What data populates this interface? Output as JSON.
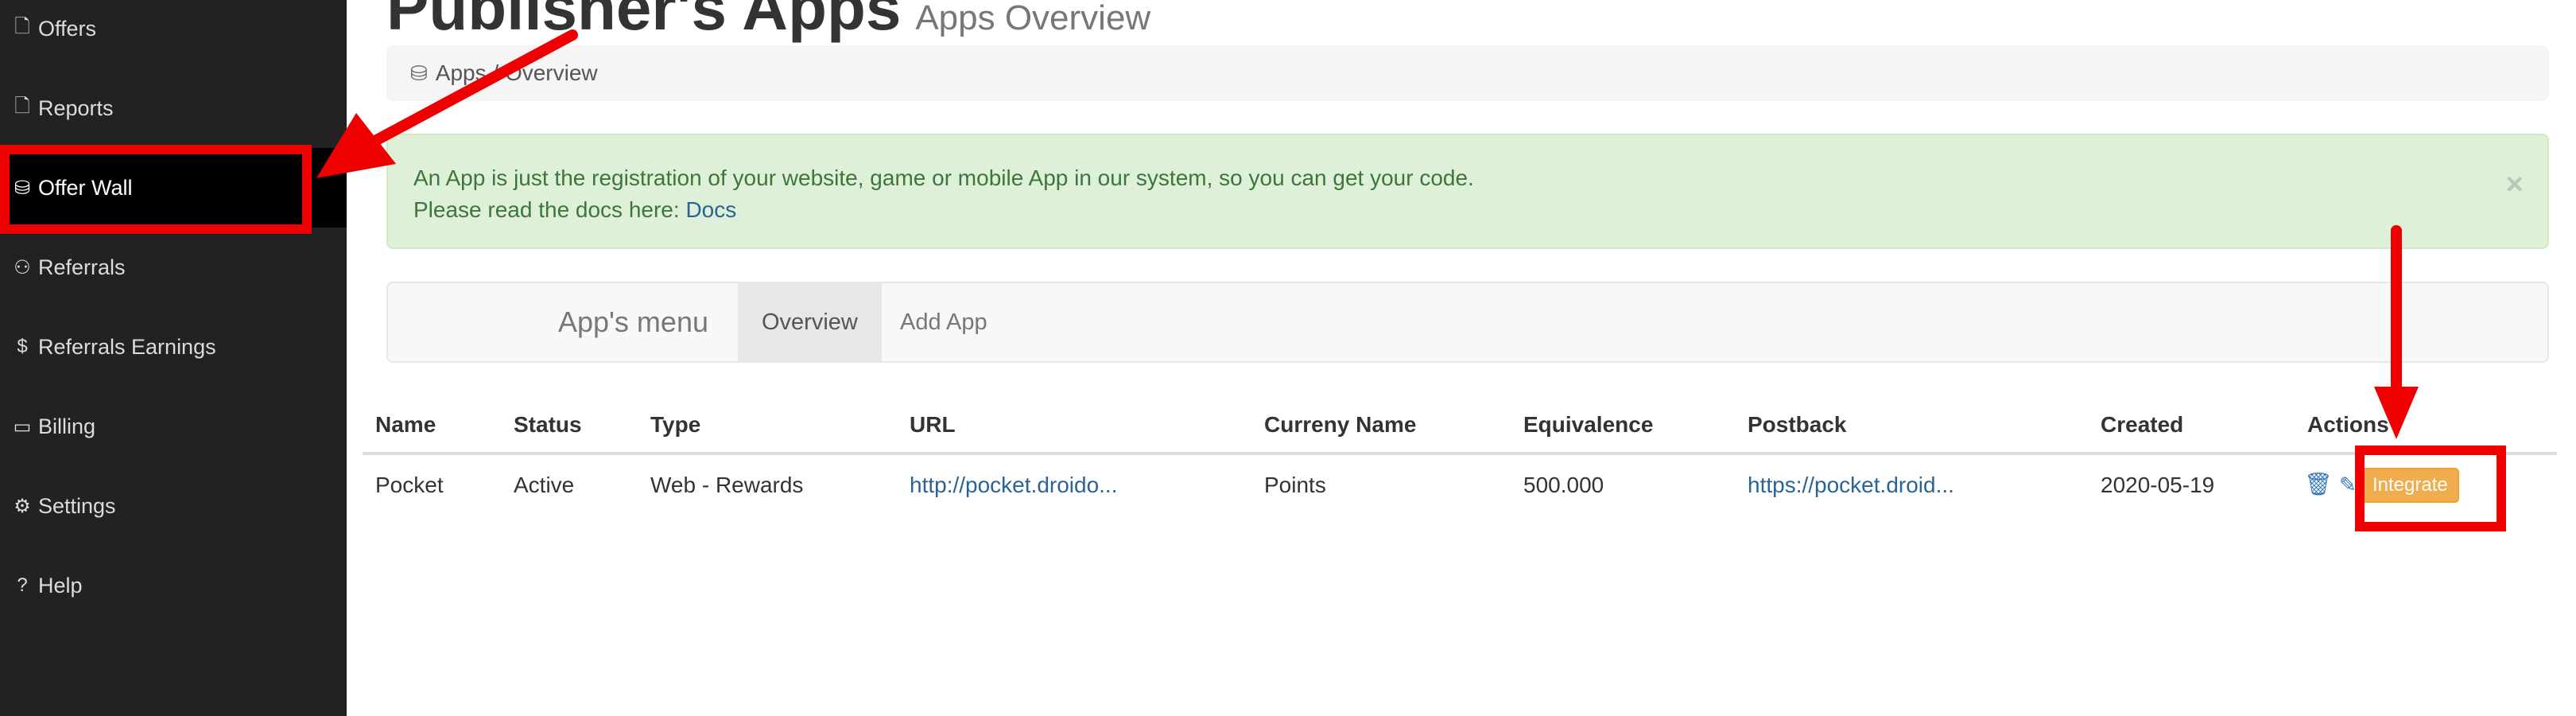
{
  "sidebar": {
    "items": [
      {
        "icon": "document-icon",
        "glyph": "🗋",
        "label": "Offers"
      },
      {
        "icon": "document-icon",
        "glyph": "🗋",
        "label": "Reports"
      },
      {
        "icon": "cubes-icon",
        "glyph": "⛁",
        "label": "Offer Wall"
      },
      {
        "icon": "sitemap-icon",
        "glyph": "⚇",
        "label": "Referrals"
      },
      {
        "icon": "dollar-icon",
        "glyph": "$",
        "label": "Referrals Earnings"
      },
      {
        "icon": "credit-card-icon",
        "glyph": "▭",
        "label": "Billing"
      },
      {
        "icon": "gears-icon",
        "glyph": "⚙",
        "label": "Settings"
      },
      {
        "icon": "question-icon",
        "glyph": "?",
        "label": "Help"
      }
    ]
  },
  "header": {
    "title": "Publisher's Apps",
    "subtitle": "Apps Overview"
  },
  "breadcrumb": {
    "text": "Apps / Overview"
  },
  "alert": {
    "line1": "An App is just the registration of your website, game or mobile App in our system, so you can get your code.",
    "line2_prefix": "Please read the docs here: ",
    "docs_link": "Docs",
    "close": "×"
  },
  "app_menu": {
    "brand": "App's menu",
    "tabs": [
      "Overview",
      "Add App"
    ]
  },
  "table": {
    "headers": [
      "Name",
      "Status",
      "Type",
      "URL",
      "Curreny Name",
      "Equivalence",
      "Postback",
      "Created",
      "Actions"
    ],
    "rows": [
      {
        "name": "Pocket",
        "status": "Active",
        "type": "Web - Rewards",
        "url": "http://pocket.droido...",
        "currency": "Points",
        "equivalence": "500.000",
        "postback": "https://pocket.droid...",
        "created": "2020-05-19",
        "integrate": "Integrate"
      }
    ]
  },
  "colors": {
    "annotation": "#ee0000",
    "sidebar_bg": "#222222",
    "integrate": "#f0ad4e"
  }
}
